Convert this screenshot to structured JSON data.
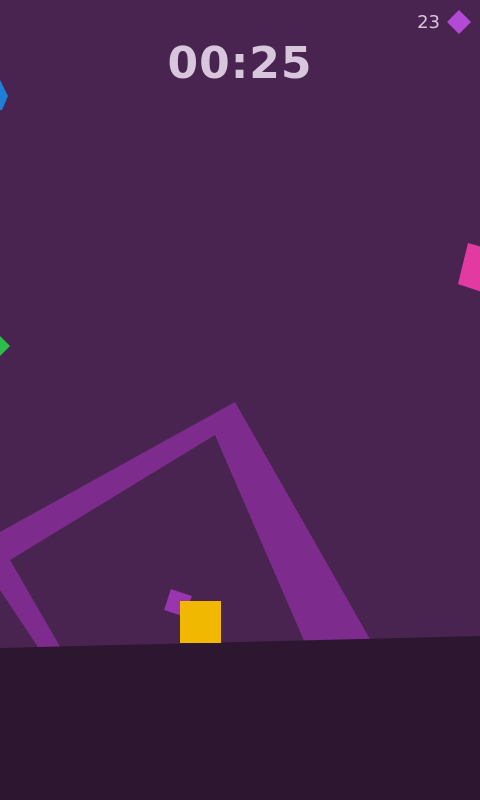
{
  "hud": {
    "timer": "00:25",
    "gem_count": "23"
  },
  "icons": {
    "gem": "diamond-gem-icon"
  },
  "colors": {
    "background": "#4a2450",
    "ground": "#2c1630",
    "frame": "#7d2c8e",
    "player": "#f0b800",
    "small_square": "#9a35b0",
    "gem": "#b34ad6",
    "hud_text": "#d8c6dc",
    "blue_block": "#1f7fd6",
    "pink_block": "#e23aa0",
    "green_block": "#2bbf4a"
  }
}
